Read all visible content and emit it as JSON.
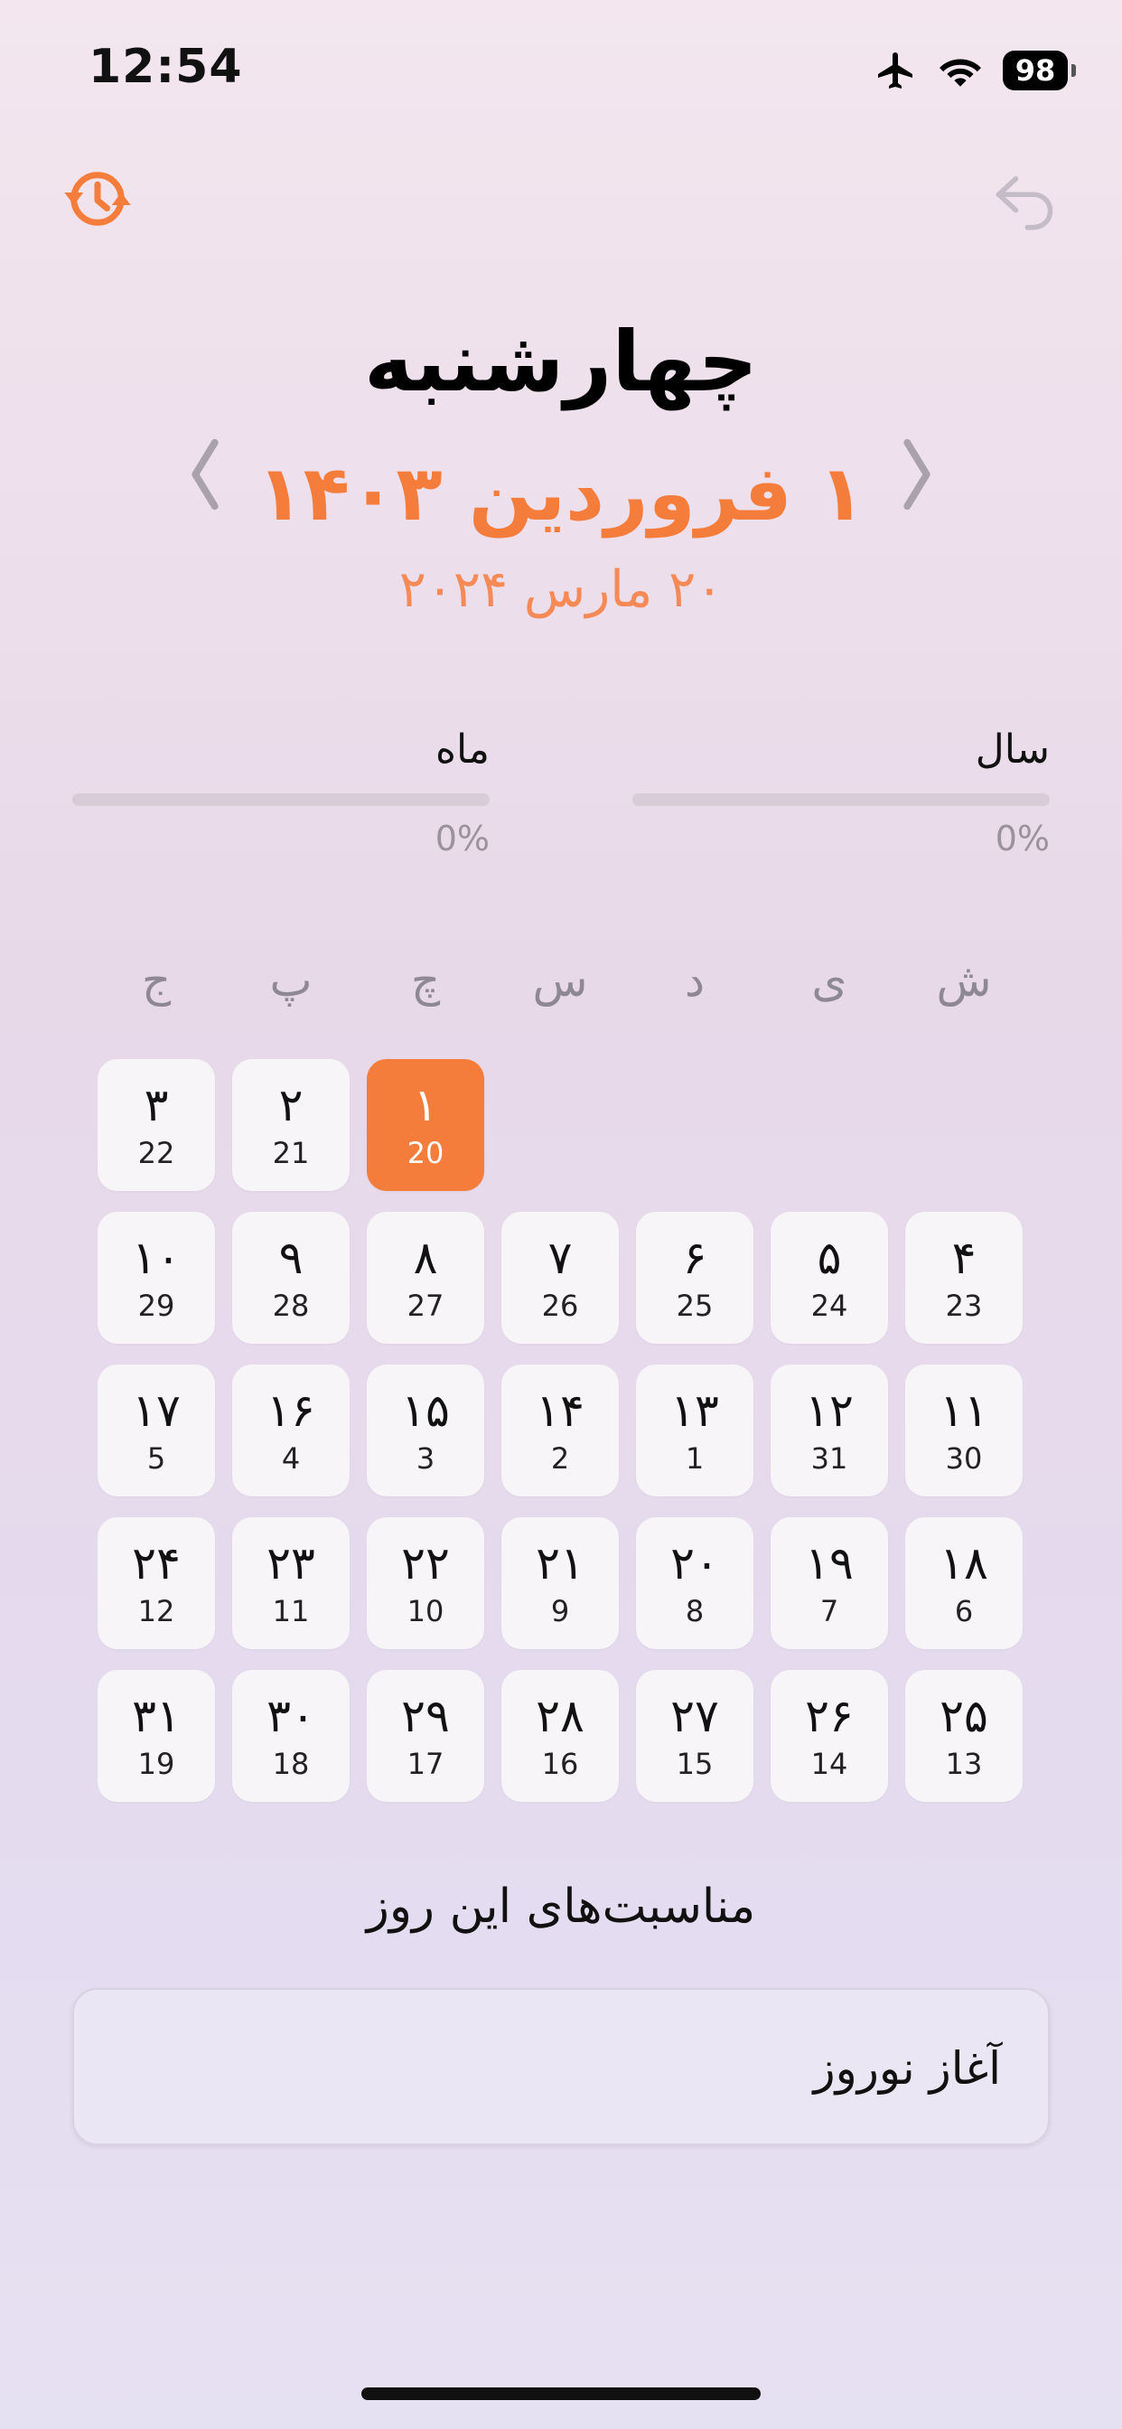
{
  "status_bar": {
    "time": "12:54",
    "battery": "98",
    "icons": [
      "airplane-icon",
      "wifi-icon",
      "battery-icon"
    ]
  },
  "header": {
    "history_icon": "history-clock-icon",
    "back_icon": "undo-arrow-icon",
    "accent_color": "#f57d3b"
  },
  "date": {
    "weekday": "چهارشنبه",
    "persian": "۱ فروردین ۱۴۰۳",
    "gregorian": "۲۰ مارس ۲۰۲۴"
  },
  "progress": {
    "year": {
      "label": "سال",
      "percent_text": "0%",
      "value": 0
    },
    "month": {
      "label": "ماه",
      "percent_text": "0%",
      "value": 0
    }
  },
  "calendar": {
    "weekdays": [
      "ش",
      "ی",
      "د",
      "س",
      "چ",
      "پ",
      "ج"
    ],
    "first_day_column": 4,
    "selected_index": 0,
    "days": [
      {
        "p": "۱",
        "g": "20"
      },
      {
        "p": "۲",
        "g": "21"
      },
      {
        "p": "۳",
        "g": "22"
      },
      {
        "p": "۴",
        "g": "23"
      },
      {
        "p": "۵",
        "g": "24"
      },
      {
        "p": "۶",
        "g": "25"
      },
      {
        "p": "۷",
        "g": "26"
      },
      {
        "p": "۸",
        "g": "27"
      },
      {
        "p": "۹",
        "g": "28"
      },
      {
        "p": "۱۰",
        "g": "29"
      },
      {
        "p": "۱۱",
        "g": "30"
      },
      {
        "p": "۱۲",
        "g": "31"
      },
      {
        "p": "۱۳",
        "g": "1"
      },
      {
        "p": "۱۴",
        "g": "2"
      },
      {
        "p": "۱۵",
        "g": "3"
      },
      {
        "p": "۱۶",
        "g": "4"
      },
      {
        "p": "۱۷",
        "g": "5"
      },
      {
        "p": "۱۸",
        "g": "6"
      },
      {
        "p": "۱۹",
        "g": "7"
      },
      {
        "p": "۲۰",
        "g": "8"
      },
      {
        "p": "۲۱",
        "g": "9"
      },
      {
        "p": "۲۲",
        "g": "10"
      },
      {
        "p": "۲۳",
        "g": "11"
      },
      {
        "p": "۲۴",
        "g": "12"
      },
      {
        "p": "۲۵",
        "g": "13"
      },
      {
        "p": "۲۶",
        "g": "14"
      },
      {
        "p": "۲۷",
        "g": "15"
      },
      {
        "p": "۲۸",
        "g": "16"
      },
      {
        "p": "۲۹",
        "g": "17"
      },
      {
        "p": "۳۰",
        "g": "18"
      },
      {
        "p": "۳۱",
        "g": "19"
      }
    ]
  },
  "occasions": {
    "title": "مناسبت‌های این روز",
    "items": [
      "آغاز نوروز"
    ]
  }
}
